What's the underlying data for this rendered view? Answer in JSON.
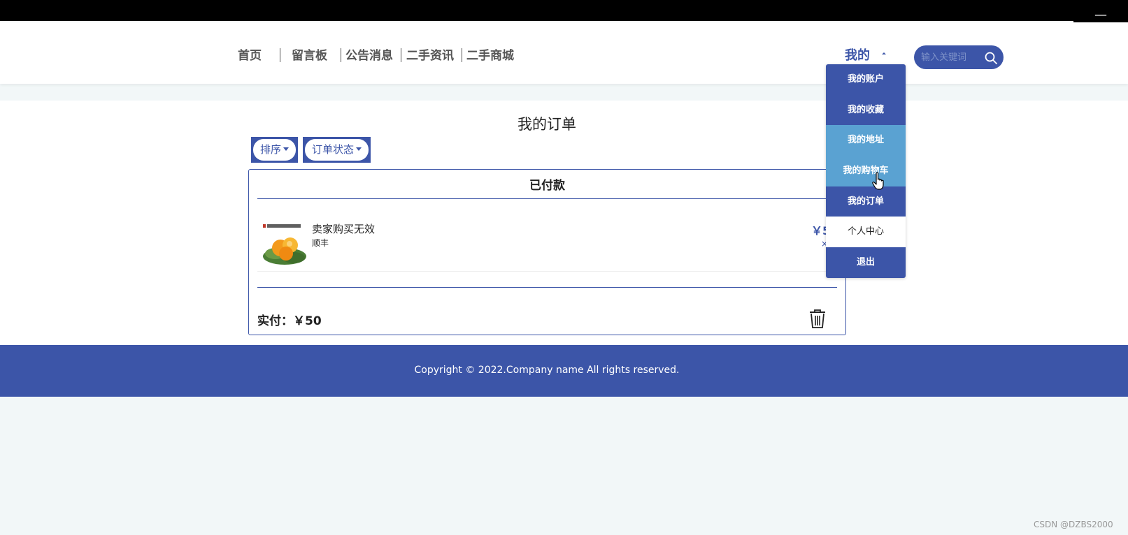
{
  "window": {
    "minimize_label": "—"
  },
  "nav": {
    "items": [
      {
        "label": "首页"
      },
      {
        "label": "留言板"
      },
      {
        "label": "公告消息"
      },
      {
        "label": "二手资讯"
      },
      {
        "label": "二手商城"
      }
    ]
  },
  "user_menu": {
    "label": "我的",
    "items": [
      {
        "label": "我的账户"
      },
      {
        "label": "我的收藏"
      },
      {
        "label": "我的地址"
      },
      {
        "label": "我的购物车"
      },
      {
        "label": "我的订单"
      },
      {
        "label": "个人中心"
      },
      {
        "label": "退出"
      }
    ]
  },
  "search": {
    "placeholder": "输入关键词",
    "value": ""
  },
  "main": {
    "title": "我的订单",
    "filters": [
      {
        "label": "排序"
      },
      {
        "label": "订单状态"
      }
    ]
  },
  "order": {
    "status": "已付款",
    "product": {
      "name": "卖家购买无效",
      "shipping": "顺丰",
      "price": "￥5",
      "qty": "×"
    },
    "paid_label": "实付：",
    "paid_amount": "￥50"
  },
  "footer": {
    "copyright": "Copyright © 2022.Company name All rights reserved."
  },
  "watermark": "CSDN @DZBS2000",
  "colors": {
    "accent": "#3c55a8",
    "highlight": "#5aa2d2",
    "background": "#f2f7f8"
  },
  "icons": {
    "search": "search-icon",
    "trash": "trash-icon",
    "cursor": "hand-cursor-icon"
  }
}
